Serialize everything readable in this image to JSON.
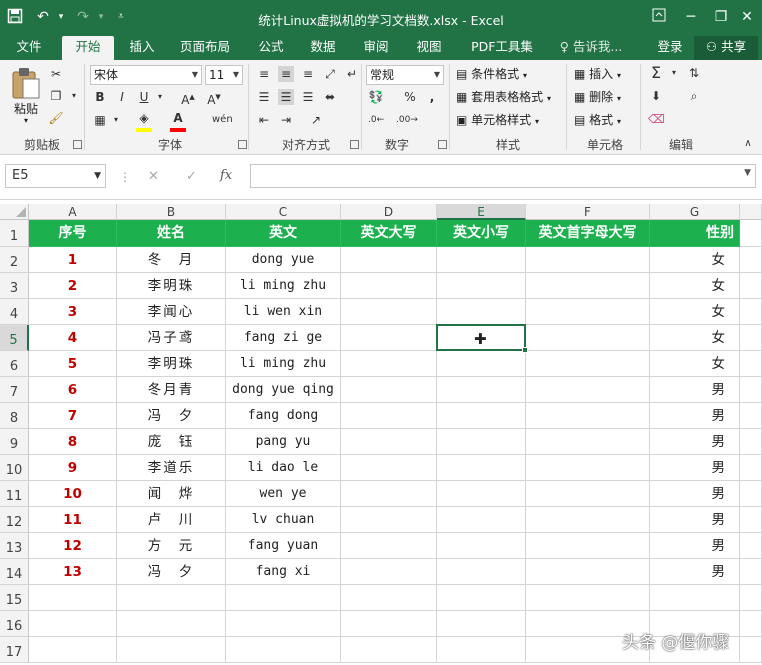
{
  "window": {
    "title": "统计Linux虚拟机的学习文档数.xlsx - Excel",
    "accent_color": "#217346"
  },
  "quick_access": {
    "save_icon": "save-icon",
    "undo_icon": "undo-icon",
    "redo_icon": "redo-icon",
    "customize_icon": "customize-icon"
  },
  "tabs": [
    "文件",
    "开始",
    "插入",
    "页面布局",
    "公式",
    "数据",
    "审阅",
    "视图",
    "PDF工具集"
  ],
  "active_tab": "开始",
  "tell_me": "告诉我...",
  "login": "登录",
  "share": "共享",
  "ribbon": {
    "clipboard": {
      "paste": "粘贴",
      "label": "剪贴板"
    },
    "font": {
      "name": "宋体",
      "size": "11",
      "bold": "B",
      "italic": "I",
      "underline": "U",
      "label": "字体",
      "fill_color": "#ffff00",
      "font_color": "#ff0000"
    },
    "alignment": {
      "label": "对齐方式"
    },
    "number": {
      "format": "常规",
      "percent": "%",
      "comma": ",",
      "label": "数字"
    },
    "styles": {
      "conditional": "条件格式",
      "table_format": "套用表格格式",
      "cell_styles": "单元格样式",
      "label": "样式"
    },
    "cells": {
      "insert": "插入",
      "delete": "删除",
      "format": "格式",
      "label": "单元格"
    },
    "editing": {
      "label": "编辑"
    }
  },
  "formula_bar": {
    "name_box": "E5",
    "fx": "fx",
    "cancel": "✕",
    "enter": "✓",
    "value": ""
  },
  "sheet": {
    "columns": [
      "A",
      "B",
      "C",
      "D",
      "E",
      "F",
      "G"
    ],
    "selected_column": "E",
    "selected_row": "5",
    "selected_cell": "E5",
    "header_fill": "#1db04e",
    "number_color": "#c00000",
    "header_row": [
      "序号",
      "姓名",
      "英文",
      "英文大写",
      "英文小写",
      "英文首字母大写",
      "性别"
    ],
    "rows": [
      {
        "rn": "2",
        "no": "1",
        "name": "冬　月",
        "en": "dong yue",
        "gender": "女"
      },
      {
        "rn": "3",
        "no": "2",
        "name": "李明珠",
        "en": "li ming zhu",
        "gender": "女"
      },
      {
        "rn": "4",
        "no": "3",
        "name": "李闻心",
        "en": "li wen xin",
        "gender": "女"
      },
      {
        "rn": "5",
        "no": "4",
        "name": "冯子鸢",
        "en": "fang zi ge",
        "gender": "女"
      },
      {
        "rn": "6",
        "no": "5",
        "name": "李明珠",
        "en": "li ming zhu",
        "gender": "女"
      },
      {
        "rn": "7",
        "no": "6",
        "name": "冬月青",
        "en": "dong yue qing",
        "gender": "男"
      },
      {
        "rn": "8",
        "no": "7",
        "name": "冯　夕",
        "en": "fang dong",
        "gender": "男"
      },
      {
        "rn": "9",
        "no": "8",
        "name": "庞　钰",
        "en": "pang yu",
        "gender": "男"
      },
      {
        "rn": "10",
        "no": "9",
        "name": "李道乐",
        "en": "li dao le",
        "gender": "男"
      },
      {
        "rn": "11",
        "no": "10",
        "name": "闻　烨",
        "en": "wen ye",
        "gender": "男"
      },
      {
        "rn": "12",
        "no": "11",
        "name": "卢　川",
        "en": "lv chuan",
        "gender": "男"
      },
      {
        "rn": "13",
        "no": "12",
        "name": "方　元",
        "en": "fang yuan",
        "gender": "男"
      },
      {
        "rn": "14",
        "no": "13",
        "name": "冯　夕",
        "en": "fang xi",
        "gender": "男"
      }
    ],
    "empty_rows": [
      "15",
      "16",
      "17"
    ]
  },
  "watermark": "头条 @偃你骤"
}
